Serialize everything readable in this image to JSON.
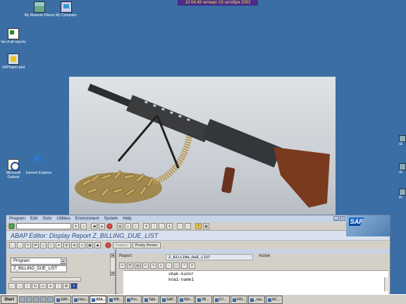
{
  "clock": "10:04:49  четверг 03 октября 2002",
  "desktop_icons": [
    {
      "label": "My Network Places",
      "icon": "network-places-icon"
    },
    {
      "label": "My Computer",
      "icon": "my-computer-icon"
    },
    {
      "label": "list of all reports",
      "icon": "document-icon"
    },
    {
      "label": "SAPlogon-pad",
      "icon": "saplogon-icon"
    },
    {
      "label": "Microsoft Outlook",
      "icon": "outlook-icon"
    },
    {
      "label": "Internet Explorer",
      "icon": "internet-explorer-icon"
    }
  ],
  "edge_icons": [
    "St",
    "St",
    "Ri"
  ],
  "sap": {
    "menu": [
      "Program",
      "Edit",
      "Goto",
      "Utilities",
      "Environment",
      "System",
      "Help"
    ],
    "logo": "SAP",
    "title": "ABAP Editor: Display Report Z_BILLING_DUE_LIST",
    "app_buttons": {
      "pattern": "Pattern",
      "pretty_printer": "Pretty Printer"
    },
    "nav": {
      "object_type": "Program",
      "object_name": "Z_BILLING_DUE_LIST"
    },
    "report": {
      "label": "Report",
      "name": "Z_BILLING_DUE_LIST",
      "status": "Active"
    },
    "code_lines": [
      "vbak-kunnr",
      "kna1-name1"
    ]
  },
  "taskbar": {
    "start": "Start",
    "tasks": [
      "SAP...",
      "Inbo...",
      "ABA...",
      "WB...",
      "Pro...",
      "Tabl...",
      "SAP...",
      "Win...",
      "ZB...",
      "D:\\...",
      "FRI...",
      "_rea...",
      "AC..."
    ]
  }
}
